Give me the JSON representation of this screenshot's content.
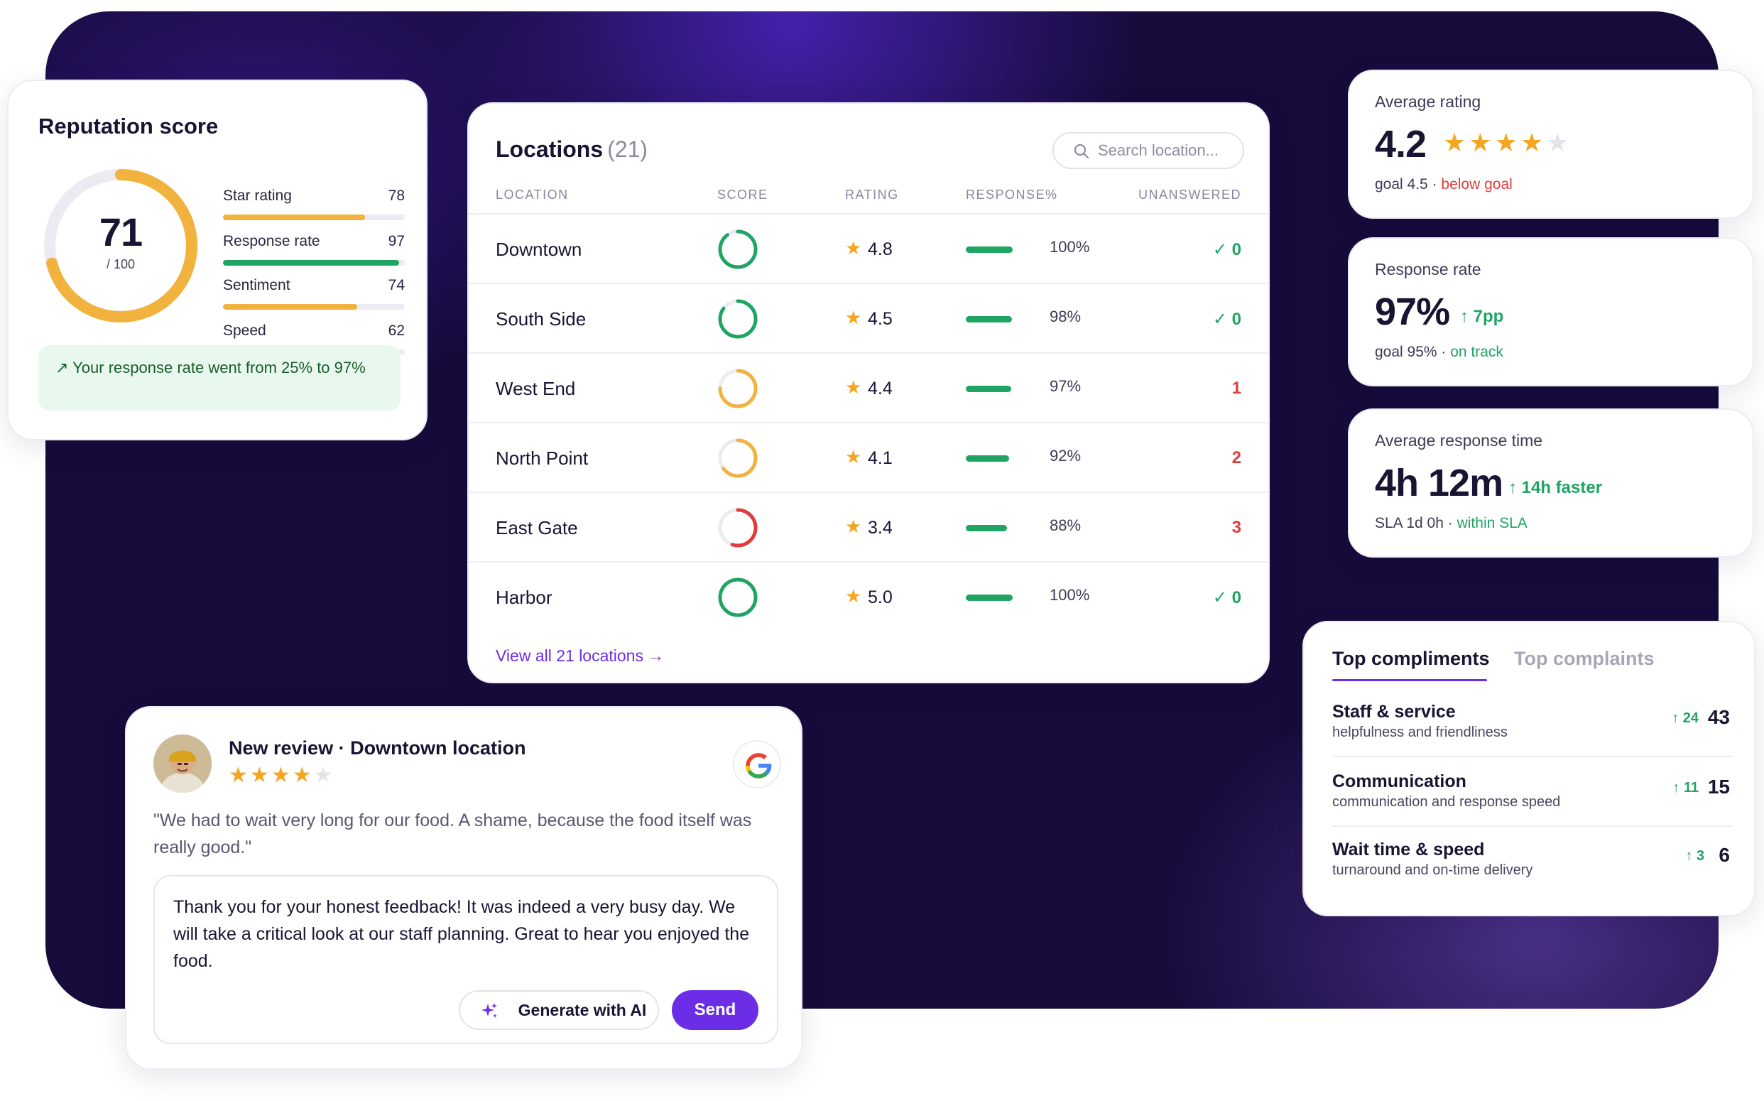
{
  "colors": {
    "accent": "#6b2ee6",
    "star": "#f4a623",
    "green": "#1fa463",
    "red": "#e23b3b",
    "orange": "#f2b23e",
    "background": "#170b3b"
  },
  "reputation": {
    "title": "Reputation score",
    "score": "71",
    "out_of": "/ 100",
    "score_value": 71,
    "metrics": [
      {
        "label": "Star rating",
        "value": "78",
        "level": 0.78,
        "color": "#f2b23e"
      },
      {
        "label": "Response rate",
        "value": "97",
        "level": 0.97,
        "color": "#1fa463"
      },
      {
        "label": "Sentiment",
        "value": "74",
        "level": 0.74,
        "color": "#f2b23e"
      },
      {
        "label": "Speed",
        "value": "62",
        "level": 0.62,
        "color": "#e23b3b"
      }
    ],
    "note": "↗ Your response rate went from 25% to 97%"
  },
  "locations": {
    "title": "Locations",
    "count": "(21)",
    "search_placeholder": "Search location...",
    "columns": {
      "location": "LOCATION",
      "score": "SCORE",
      "rating": "RATING",
      "response": "RESPONSE%",
      "unanswered": "UNANSWERED"
    },
    "rows": [
      {
        "name": "Downtown",
        "score_level": 0.9,
        "score_color": "#1fa463",
        "rating": "4.8",
        "response": "100%",
        "response_level": 1.0,
        "unanswered": "✓ 0",
        "ok": true
      },
      {
        "name": "South Side",
        "score_level": 0.85,
        "score_color": "#1fa463",
        "rating": "4.5",
        "response": "98%",
        "response_level": 0.98,
        "unanswered": "✓ 0",
        "ok": true
      },
      {
        "name": "West End",
        "score_level": 0.75,
        "score_color": "#f2b23e",
        "rating": "4.4",
        "response": "97%",
        "response_level": 0.97,
        "unanswered": "1",
        "ok": false
      },
      {
        "name": "North Point",
        "score_level": 0.65,
        "score_color": "#f2b23e",
        "rating": "4.1",
        "response": "92%",
        "response_level": 0.92,
        "unanswered": "2",
        "ok": false
      },
      {
        "name": "East Gate",
        "score_level": 0.55,
        "score_color": "#e23b3b",
        "rating": "3.4",
        "response": "88%",
        "response_level": 0.88,
        "unanswered": "3",
        "ok": false
      },
      {
        "name": "Harbor",
        "score_level": 1.0,
        "score_color": "#1fa463",
        "rating": "5.0",
        "response": "100%",
        "response_level": 1.0,
        "unanswered": "✓ 0",
        "ok": true
      }
    ],
    "view_all": "View all 21 locations →"
  },
  "kpis": {
    "avg_rating": {
      "title": "Average rating",
      "value": "4.2",
      "stars_filled": 4,
      "stars_total": 5,
      "goal": "goal 4.5 · ",
      "goal_status": "below goal"
    },
    "response_rate": {
      "title": "Response rate",
      "value": "97%",
      "delta": "↑ 7pp",
      "goal": "goal 95% · ",
      "goal_status": "on track"
    },
    "response_time": {
      "title": "Average response time",
      "value": "4h 12m",
      "delta": "↑ 14h faster",
      "goal": "SLA 1d 0h · ",
      "goal_status": "within SLA"
    }
  },
  "feedback": {
    "tabs": [
      "Top compliments",
      "Top complaints"
    ],
    "items": [
      {
        "title": "Staff & service",
        "subtitle": "helpfulness and friendliness",
        "delta": "↑ 24",
        "count": "43"
      },
      {
        "title": "Communication",
        "subtitle": "communication and response speed",
        "delta": "↑ 11",
        "count": "15"
      },
      {
        "title": "Wait time & speed",
        "subtitle": "turnaround and on-time delivery",
        "delta": "↑ 3",
        "count": "6"
      }
    ]
  },
  "review": {
    "heading": "New review · Downtown location",
    "stars_filled": 4,
    "stars_total": 5,
    "quote": "\"We had to wait very long for our food. A shame, because the food itself was really good.\"",
    "reply": "Thank you for your honest feedback! It was indeed a very busy day. We will take a critical look at our staff planning. Great to hear you enjoyed the food.",
    "ai_button": "Generate with AI",
    "send_button": "Send",
    "source_icon": "google-icon"
  }
}
